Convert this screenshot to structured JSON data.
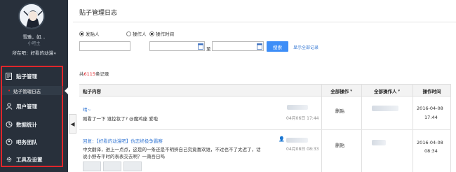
{
  "sidebar": {
    "username": "雪雅，如...",
    "user_level": "小吧主",
    "forum_label": "所在吧：好看的动漫",
    "menu": [
      {
        "label": "贴子管理",
        "icon": "document-icon"
      },
      {
        "label": "用户管理",
        "icon": "user-icon"
      },
      {
        "label": "数据统计",
        "icon": "chart-icon"
      },
      {
        "label": "吧务团队",
        "icon": "team-icon"
      },
      {
        "label": "工具及设置",
        "icon": "gear-icon"
      }
    ],
    "submenu_active": "贴子管理日志",
    "highlight_color": "#e0262b"
  },
  "page": {
    "title": "贴子管理日志"
  },
  "filters": {
    "radio_poster": "发贴人",
    "radio_operator": "操作人",
    "radio_time": "操作时间",
    "to_label": "至",
    "search_label": "搜索",
    "show_all_label": "显示全部记录"
  },
  "summary": {
    "prefix": "共",
    "count": "6115",
    "suffix": "条记录"
  },
  "table": {
    "headers": {
      "content": "贴子内容",
      "all_ops": "全部操作",
      "all_operators": "全部操作人",
      "op_time": "操作时间"
    },
    "rows": [
      {
        "title": "晴~",
        "body": "刚看了一下 谁控妆了? @魔鸡座 爱啦",
        "post_time": "04月06日 17:44",
        "operation": "删贴",
        "op_date": "2016-04-08",
        "op_clock": "17:44"
      },
      {
        "title": "回复：【好看的动漫吧】伪恋终极争霸赛",
        "body": "中文翻译，进上一点点，这是的一条还是不明辨自己究竟喜欢谁，不过也不了太迟了，话",
        "body2": "说小野寺平时的表表交去啊？一萧吾日吗",
        "post_time": "04月08日 08:33",
        "operation": "删贴",
        "op_date": "2016-04-08",
        "op_clock": "08:34"
      }
    ]
  }
}
